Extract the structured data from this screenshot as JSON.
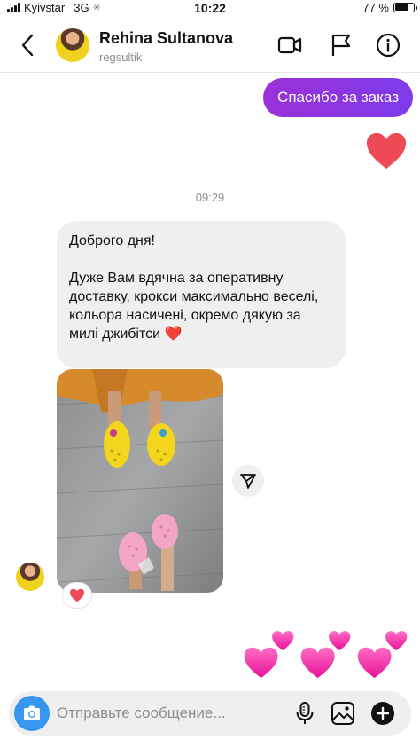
{
  "status_bar": {
    "carrier": "Kyivstar",
    "network": "3G",
    "time": "10:22",
    "battery_percent": "77 %",
    "battery_level": 0.77
  },
  "header": {
    "name": "Rehina Sultanova",
    "username": "regsultik"
  },
  "messages": {
    "outgoing_text": "Спасибо за заказ",
    "timestamp": "09:29",
    "incoming_text": "Доброго дня!\n\nДуже Вам вдячна за оперативну доставку, крокси максимально веселі, кольора насичені, окремо дякую за милі джибітси ❤️"
  },
  "composer": {
    "placeholder": "Отправьте сообщение..."
  },
  "colors": {
    "accent": "#3797f0",
    "outgoing_bubble": "#8e2de2",
    "heart": "#ed4956",
    "pink_heart": "#ff3ea5",
    "incoming_bubble": "#efefef"
  },
  "icons": [
    "chevron-left-icon",
    "video-camera-icon",
    "flag-icon",
    "info-icon",
    "heart-icon",
    "paper-plane-icon",
    "camera-icon",
    "microphone-icon",
    "gallery-icon",
    "plus-icon"
  ]
}
